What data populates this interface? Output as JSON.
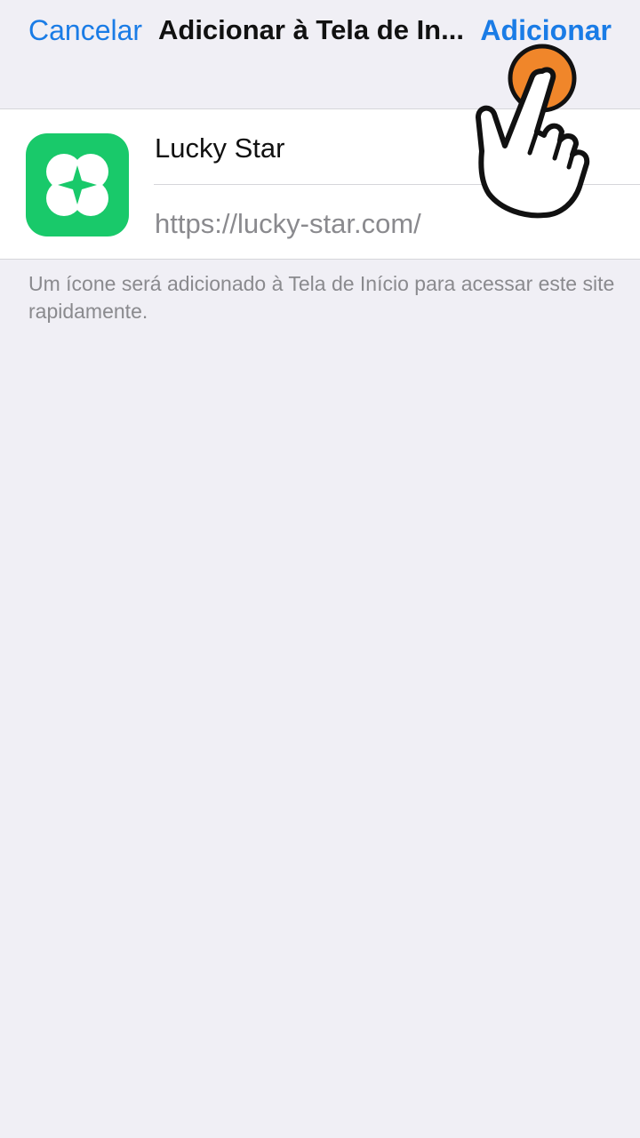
{
  "navbar": {
    "cancel_label": "Cancelar",
    "title": "Adicionar à Tela de In...",
    "add_label": "Adicionar"
  },
  "card": {
    "app_name": "Lucky Star",
    "url": "https://lucky-star.com/"
  },
  "footnote": "Um ícone será adicionado à Tela de Início para acessar este site rapidamente.",
  "icons": {
    "app_icon": "clover-star-icon",
    "hand_pointer": "tap-hand-icon"
  },
  "colors": {
    "accent": "#1a7ce6",
    "background": "#f0eff5",
    "app_icon_green": "#19c96a",
    "tap_indicator": "#f0862a"
  }
}
